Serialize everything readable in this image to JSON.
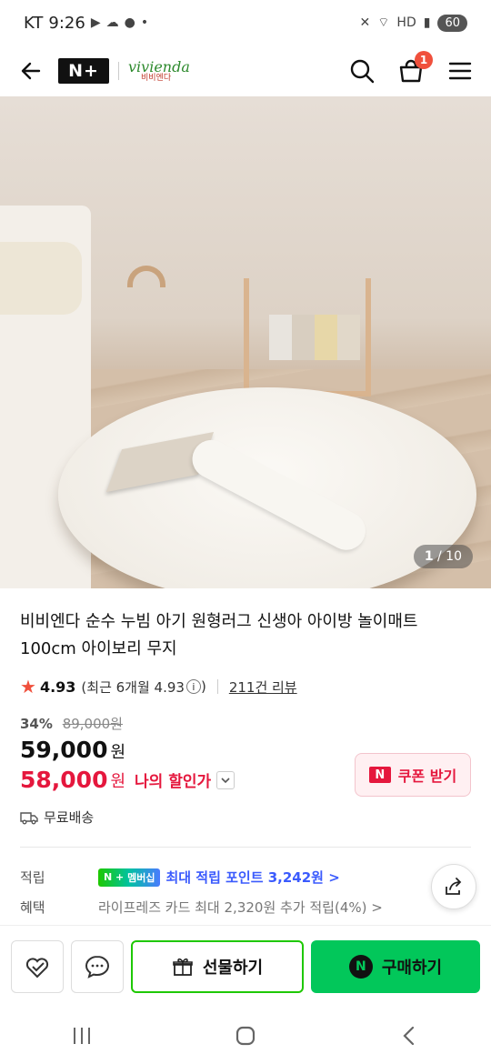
{
  "status": {
    "carrier": "KT",
    "time": "9:26",
    "battery": "60"
  },
  "appbar": {
    "brand_name": "vivienda",
    "brand_sub": "비비엔다",
    "cart_count": "1"
  },
  "gallery": {
    "current": "1",
    "total": "/ 10"
  },
  "product": {
    "title": "비비엔다 순수 누빔 아기 원형러그 신생아 아이방 놀이매트 100cm 아이보리 무지",
    "rating": "4.93",
    "rating_recent": "(최근 6개월 4.93",
    "review_count": "211건 리뷰",
    "discount_pct": "34%",
    "original_price": "89,000원",
    "price": "59,000",
    "price_unit": "원",
    "my_price": "58,000",
    "my_price_unit": "원",
    "my_price_label": "나의 할인가",
    "coupon_label": "쿠폰 받기",
    "shipping": "무료배송"
  },
  "points": {
    "label": "적립",
    "badge": "멤버십",
    "text": "최대 적립 포인트 3,242원 >"
  },
  "benefit": {
    "label": "혜택",
    "text": "라이프레즈 카드 최대 2,320원 추가 적립(4%) >"
  },
  "bottombar": {
    "gift_label": "선물하기",
    "buy_label": "구매하기"
  },
  "colors": {
    "accent_red": "#e5173d",
    "naver_green": "#02c75a",
    "points_blue": "#3b5bfd"
  }
}
